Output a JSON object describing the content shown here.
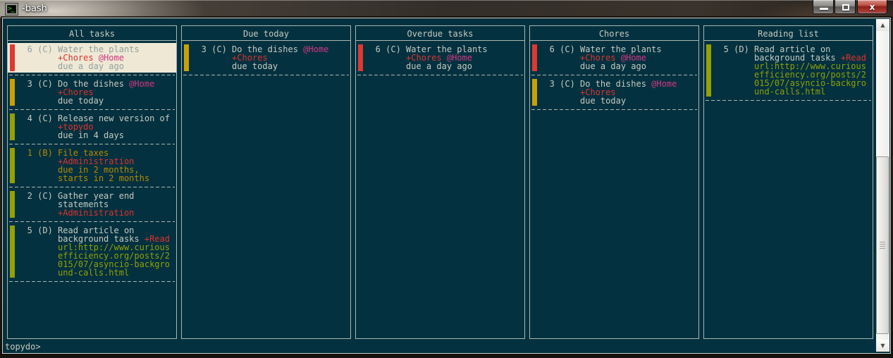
{
  "window": {
    "title": "-bash",
    "icon": "terminal-icon",
    "icon_glyph": ">_",
    "controls": {
      "minimize": "minimize",
      "restore": "restore",
      "close": "close",
      "close_glyph": "x"
    }
  },
  "palette": {
    "bg": "#04313f",
    "fg": "#c5cac1",
    "dim": "#93a1a1",
    "red": "#dc322f",
    "magenta": "#d33682",
    "yellow": "#b58900",
    "green": "#8fa005",
    "cream": "#eee8d5",
    "border": "#a9b7b0",
    "bar-red": "#dd3a30",
    "bar-gold": "#c9a106",
    "bar-olive": "#93a104"
  },
  "prompt": {
    "text": "topydo>"
  },
  "scrollbar": {
    "up_glyph": "▲",
    "down_glyph": "▼"
  },
  "board": {
    "columns": [
      {
        "title": "All tasks",
        "items": [
          {
            "bar": "red",
            "selected": true,
            "lines": [
              [
                {
                  "t": "   6 (C) Water the plants",
                  "c": "dim"
                }
              ],
              [
                {
                  "t": "         ",
                  "c": "dim"
                },
                {
                  "t": "+Chores",
                  "c": "red"
                },
                {
                  "t": " ",
                  "c": "dim"
                },
                {
                  "t": "@Home",
                  "c": "mag"
                }
              ],
              [
                {
                  "t": "         due a day ago",
                  "c": "dim"
                }
              ]
            ]
          },
          {
            "bar": "gold",
            "selected": false,
            "lines": [
              [
                {
                  "t": "   3 (C) Do the dishes ",
                  "c": "fg"
                },
                {
                  "t": "@Home",
                  "c": "mag"
                }
              ],
              [
                {
                  "t": "         ",
                  "c": "fg"
                },
                {
                  "t": "+Chores",
                  "c": "red"
                }
              ],
              [
                {
                  "t": "         due today",
                  "c": "fg"
                }
              ]
            ]
          },
          {
            "bar": "olive",
            "selected": false,
            "lines": [
              [
                {
                  "t": "   4 (C) Release new version of",
                  "c": "fg"
                }
              ],
              [
                {
                  "t": "         ",
                  "c": "fg"
                },
                {
                  "t": "+topydo",
                  "c": "red"
                }
              ],
              [
                {
                  "t": "         due in 4 days",
                  "c": "fg"
                }
              ]
            ]
          },
          {
            "bar": "olive",
            "selected": false,
            "lines": [
              [
                {
                  "t": "   1 (B) File taxes",
                  "c": "yel"
                }
              ],
              [
                {
                  "t": "         ",
                  "c": "fg"
                },
                {
                  "t": "+Administration",
                  "c": "red"
                }
              ],
              [
                {
                  "t": "         due in 2 months,",
                  "c": "yel"
                }
              ],
              [
                {
                  "t": "         starts in 2 months",
                  "c": "yel"
                }
              ]
            ]
          },
          {
            "bar": "olive",
            "selected": false,
            "lines": [
              [
                {
                  "t": "   2 (C) Gather year end",
                  "c": "fg"
                }
              ],
              [
                {
                  "t": "         statements",
                  "c": "fg"
                }
              ],
              [
                {
                  "t": "         ",
                  "c": "fg"
                },
                {
                  "t": "+Administration",
                  "c": "red"
                }
              ]
            ]
          },
          {
            "bar": "olive",
            "selected": false,
            "lines": [
              [
                {
                  "t": "   5 (D) Read article on",
                  "c": "fg"
                }
              ],
              [
                {
                  "t": "         background tasks ",
                  "c": "fg"
                },
                {
                  "t": "+Read",
                  "c": "red"
                }
              ],
              [
                {
                  "t": "         url:http://www.curious",
                  "c": "grn"
                }
              ],
              [
                {
                  "t": "         efficiency.org/posts/2",
                  "c": "grn"
                }
              ],
              [
                {
                  "t": "         015/07/asyncio-backgro",
                  "c": "grn"
                }
              ],
              [
                {
                  "t": "         und-calls.html",
                  "c": "grn"
                }
              ]
            ]
          }
        ]
      },
      {
        "title": "Due today",
        "items": [
          {
            "bar": "gold",
            "selected": false,
            "lines": [
              [
                {
                  "t": "   3 (C) Do the dishes ",
                  "c": "fg"
                },
                {
                  "t": "@Home",
                  "c": "mag"
                }
              ],
              [
                {
                  "t": "         ",
                  "c": "fg"
                },
                {
                  "t": "+Chores",
                  "c": "red"
                }
              ],
              [
                {
                  "t": "         due today",
                  "c": "fg"
                }
              ]
            ]
          }
        ]
      },
      {
        "title": "Overdue tasks",
        "items": [
          {
            "bar": "red",
            "selected": false,
            "lines": [
              [
                {
                  "t": "   6 (C) Water the plants",
                  "c": "fg"
                }
              ],
              [
                {
                  "t": "         ",
                  "c": "fg"
                },
                {
                  "t": "+Chores",
                  "c": "red"
                },
                {
                  "t": " ",
                  "c": "fg"
                },
                {
                  "t": "@Home",
                  "c": "mag"
                }
              ],
              [
                {
                  "t": "         due a day ago",
                  "c": "fg"
                }
              ]
            ]
          }
        ]
      },
      {
        "title": "Chores",
        "items": [
          {
            "bar": "red",
            "selected": false,
            "lines": [
              [
                {
                  "t": "   6 (C) Water the plants",
                  "c": "fg"
                }
              ],
              [
                {
                  "t": "         ",
                  "c": "fg"
                },
                {
                  "t": "+Chores",
                  "c": "red"
                },
                {
                  "t": " ",
                  "c": "fg"
                },
                {
                  "t": "@Home",
                  "c": "mag"
                }
              ],
              [
                {
                  "t": "         due a day ago",
                  "c": "fg"
                }
              ]
            ]
          },
          {
            "bar": "gold",
            "selected": false,
            "lines": [
              [
                {
                  "t": "   3 (C) Do the dishes ",
                  "c": "fg"
                },
                {
                  "t": "@Home",
                  "c": "mag"
                }
              ],
              [
                {
                  "t": "         ",
                  "c": "fg"
                },
                {
                  "t": "+Chores",
                  "c": "red"
                }
              ],
              [
                {
                  "t": "         due today",
                  "c": "fg"
                }
              ]
            ]
          }
        ]
      },
      {
        "title": "Reading list",
        "items": [
          {
            "bar": "olive",
            "selected": false,
            "lines": [
              [
                {
                  "t": "   5 (D) Read article on",
                  "c": "fg"
                }
              ],
              [
                {
                  "t": "         background tasks ",
                  "c": "fg"
                },
                {
                  "t": "+Read",
                  "c": "red"
                }
              ],
              [
                {
                  "t": "         url:http://www.curious",
                  "c": "grn"
                }
              ],
              [
                {
                  "t": "         efficiency.org/posts/2",
                  "c": "grn"
                }
              ],
              [
                {
                  "t": "         015/07/asyncio-backgro",
                  "c": "grn"
                }
              ],
              [
                {
                  "t": "         und-calls.html",
                  "c": "grn"
                }
              ]
            ]
          }
        ]
      }
    ]
  }
}
